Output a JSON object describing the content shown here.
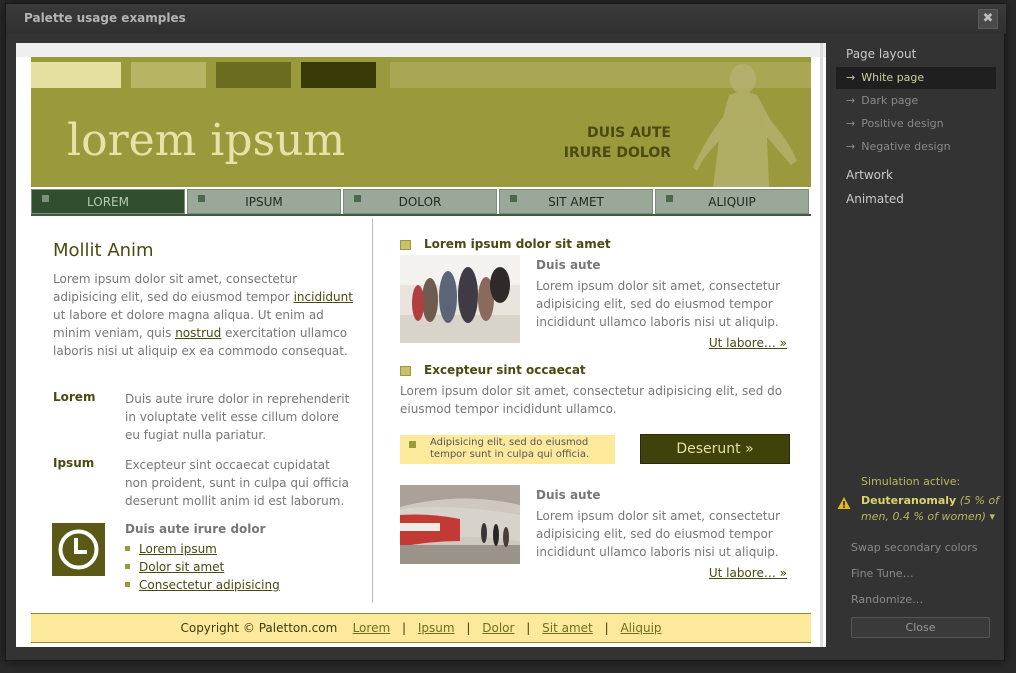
{
  "dialog": {
    "title": "Palette usage examples",
    "close_glyph": "✖"
  },
  "preview": {
    "logo_text": "lorem ipsum",
    "tagline": [
      "DUIS AUTE",
      "IRURE DOLOR"
    ],
    "nav": [
      "LOREM",
      "IPSUM",
      "DOLOR",
      "SIT AMET",
      "ALIQUIP"
    ],
    "left": {
      "title": "Mollit Anim",
      "para": {
        "t1": "Lorem ipsum dolor sit amet, consectetur adipisicing elit, sed do eiusmod tempor",
        "link1": "incididunt",
        "t2": "ut labore et dolore magna aliqua. Ut enim ad minim veniam, quis",
        "link2": "nostrud",
        "t3": "exercitation ullamco laboris nisi ut aliquip ex ea commodo consequat."
      },
      "defs": [
        {
          "term": "Lorem",
          "desc": "Duis aute irure dolor in reprehenderit in voluptate velit esse cillum dolore eu fugiat nulla pariatur."
        },
        {
          "term": "Ipsum",
          "desc": "Excepteur sint occaecat cupidatat non proident, sunt in culpa qui officia deserunt mollit anim id est laborum."
        }
      ],
      "list_title": "Duis aute irure dolor",
      "list": [
        "Lorem ipsum",
        "Dolor sit amet",
        "Consectetur adipisicing"
      ]
    },
    "right": {
      "section1": "Lorem ipsum dolor sit amet",
      "article_head": "Duis aute",
      "article_body": "Lorem ipsum dolor sit amet, consectetur adipisicing elit, sed do eiusmod tempor incididunt ullamco laboris nisi ut aliquip.",
      "more": "Ut labore… »",
      "section2": "Excepteur sint occaecat",
      "section2_body": "Lorem ipsum dolor sit amet, consectetur adipisicing elit, sed do eiusmod tempor incididunt ullamco.",
      "note": "Adipisicing elit, sed do eiusmod tempor sunt in culpa qui officia.",
      "cta": "Deserunt »",
      "article2_head": "Duis aute",
      "article2_body": "Lorem ipsum dolor sit amet, consectetur adipisicing elit, sed do eiusmod tempor incididunt ullamco laboris nisi ut aliquip.",
      "more2": "Ut labore… »"
    },
    "footer": {
      "copyright": "Copyright © Paletton.com",
      "links": [
        "Lorem",
        "Ipsum",
        "Dolor",
        "Sit amet",
        "Aliquip"
      ],
      "separator": "|"
    }
  },
  "panel": {
    "page_layout": "Page layout",
    "layouts": [
      "White page",
      "Dark page",
      "Positive design",
      "Negative design"
    ],
    "active_layout": "White page",
    "arrow": "→",
    "artwork": "Artwork",
    "animated": "Animated",
    "sim_label": "Simulation active:",
    "sim_name": "Deuteranomaly",
    "sim_detail": "(5 % of men, 0.4 % of women)",
    "sim_caret": "▾",
    "actions": [
      "Swap secondary colors",
      "Fine Tune…",
      "Randomize…"
    ],
    "close": "Close"
  },
  "colors": {
    "header": "#9a9a3d",
    "palette": [
      "#e6e0a0",
      "#b7b563",
      "#6c6c1e",
      "#3a3a08"
    ],
    "nav": "#9aa89a",
    "nav_active": "#2f4f2f",
    "accent_light": "#fde99b",
    "cta": "#3f420a"
  },
  "icons": [
    "close-icon",
    "clock-icon",
    "warning-icon",
    "arrow-right-icon"
  ]
}
